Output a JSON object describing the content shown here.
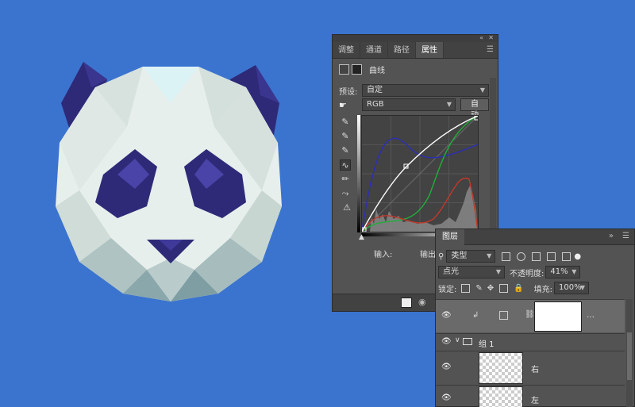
{
  "properties_panel": {
    "tabs": [
      {
        "label": "调整"
      },
      {
        "label": "通道"
      },
      {
        "label": "路径"
      },
      {
        "label": "属性"
      }
    ],
    "active_tab": "属性",
    "layer_type_label": "曲线",
    "preset_label": "预设:",
    "preset_value": "自定",
    "channel_value": "RGB",
    "auto_button": "自动",
    "input_label": "输入:",
    "output_label": "输出:",
    "curves": {
      "white_black_points": "RGB",
      "colors": {
        "rgb": "#ffffff",
        "red": "#c0392b",
        "green": "#1fae3a",
        "blue": "#2c2fb5",
        "histogram": "#9a9a9a"
      }
    }
  },
  "layers_panel": {
    "tab": "图层",
    "filter_kind": "类型",
    "blend_mode": "点光",
    "opacity_label": "不透明度:",
    "opacity_value": "41%",
    "lock_label": "锁定:",
    "fill_label": "填充:",
    "fill_value": "100%",
    "layers": [
      {
        "name": "",
        "type": "curves-adjustment",
        "selected": true
      },
      {
        "name": "组 1",
        "type": "group",
        "expanded": true
      },
      {
        "name": "右",
        "type": "pixel"
      },
      {
        "name": "左",
        "type": "pixel"
      }
    ]
  },
  "canvas": {
    "background": "#3b74cf",
    "panda_face": "#e9f0ec",
    "panda_dark": "#2e2a78"
  }
}
